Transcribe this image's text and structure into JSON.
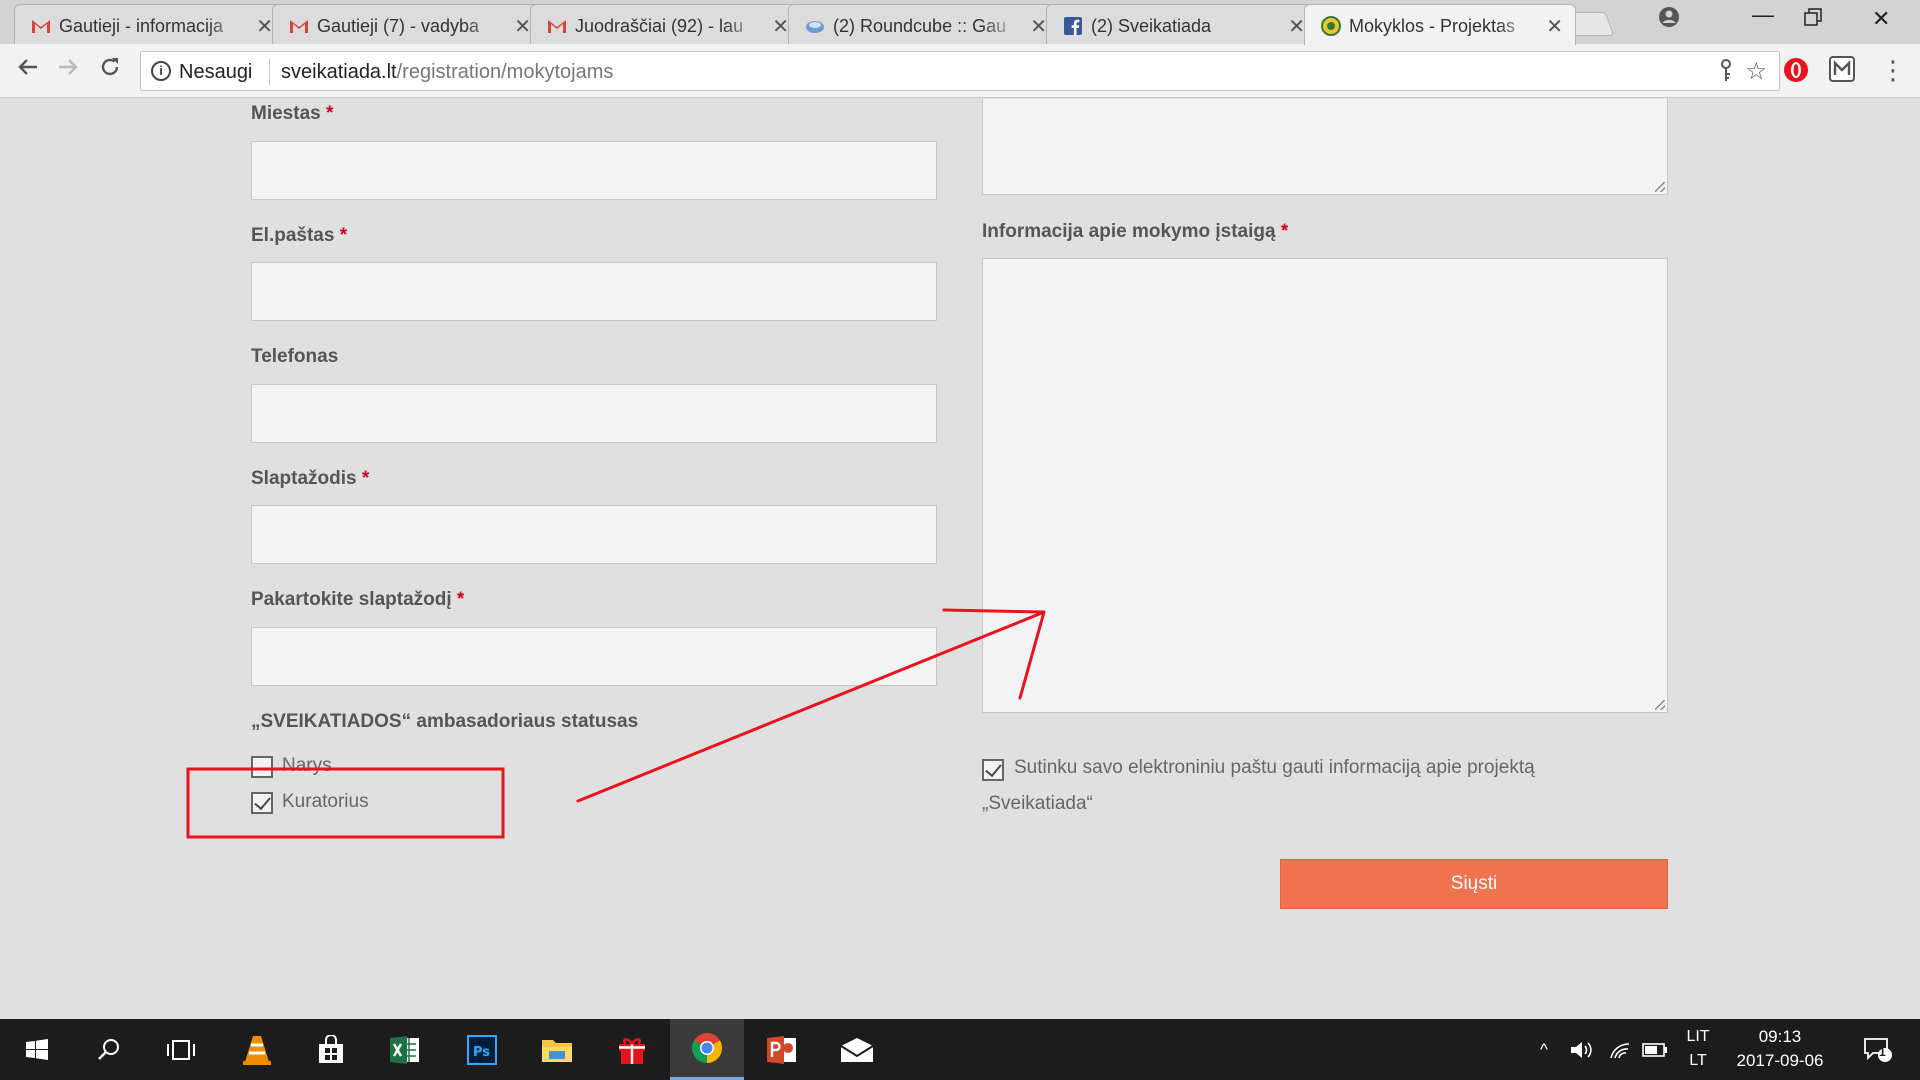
{
  "browser": {
    "tabs": [
      {
        "title": "Gautieji - informacija",
        "icon": "gmail-icon"
      },
      {
        "title": "Gautieji (7) - vadyba",
        "icon": "gmail-icon"
      },
      {
        "title": "Juodraščiai (92) - lau",
        "icon": "gmail-icon"
      },
      {
        "title": "(2) Roundcube :: Gau",
        "icon": "roundcube-icon"
      },
      {
        "title": "(2) Sveikatiada",
        "icon": "facebook-icon"
      },
      {
        "title": "Mokyklos - Projektas",
        "icon": "sveikatiada-icon",
        "active": true
      }
    ],
    "address": {
      "security_label": "Nesaugi",
      "domain": "sveikatiada.lt",
      "path": "/registration/mokytojams"
    }
  },
  "form": {
    "left": {
      "city_label": "Miestas",
      "email_label": "El.paštas",
      "phone_label": "Telefonas",
      "password_label": "Slaptažodis",
      "password_repeat_label": "Pakartokite slaptažodį",
      "status_heading": "„SVEIKATIADOS“ ambasadoriaus statusas",
      "status_options": [
        {
          "label": "Narys",
          "checked": false
        },
        {
          "label": "Kuratorius",
          "checked": true
        }
      ]
    },
    "right": {
      "institution_info_label": "Informacija apie mokymo įstaigą",
      "consent_line1": "Sutinku savo elektroniniu paštu gauti informaciją apie projektą",
      "consent_line2": "„Sveikatiada“",
      "consent_checked": true,
      "submit_label": "Siųsti"
    },
    "required_mark": "*"
  },
  "taskbar": {
    "lang_top": "LIT",
    "lang_bottom": "LT",
    "time": "09:13",
    "date": "2017-09-06",
    "notification_count": "1"
  },
  "colors": {
    "accent": "#f07350",
    "required": "#d0021b",
    "annotation": "#e8131d"
  }
}
